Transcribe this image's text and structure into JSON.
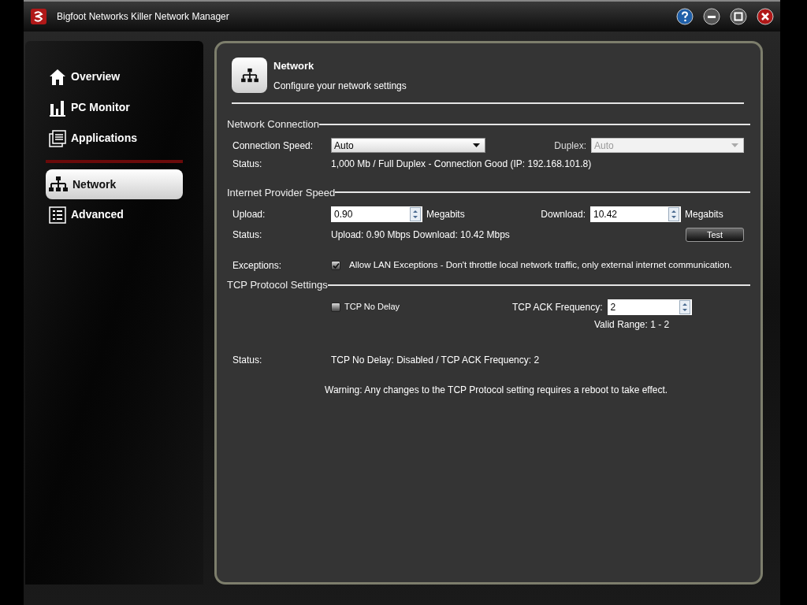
{
  "window": {
    "title": "Bigfoot Networks Killer Network Manager"
  },
  "sidebar": {
    "groups": [
      [
        {
          "label": "Overview",
          "selected": false
        },
        {
          "label": "PC Monitor",
          "selected": false
        },
        {
          "label": "Applications",
          "selected": false
        }
      ],
      [
        {
          "label": "Network",
          "selected": true
        },
        {
          "label": "Advanced",
          "selected": false
        }
      ]
    ]
  },
  "header": {
    "title": "Network",
    "subtitle": "Configure your network settings"
  },
  "network_connection": {
    "heading": "Network Connection",
    "speed_label": "Connection Speed:",
    "speed_value": "Auto",
    "duplex_label": "Duplex:",
    "duplex_value": "Auto",
    "duplex_disabled": true,
    "status_label": "Status:",
    "status": "1,000 Mb / Full Duplex - Connection Good (IP: 192.168.101.8)"
  },
  "provider_speed": {
    "heading": "Internet Provider Speed",
    "upload_label": "Upload:",
    "upload_value": "0.90",
    "upload_unit": "Megabits",
    "download_label": "Download:",
    "download_value": "10.42",
    "download_unit": "Megabits",
    "status_label": "Status:",
    "status": "Upload: 0.90 Mbps Download: 10.42 Mbps",
    "test_button": "Test",
    "exceptions_label": "Exceptions:",
    "exceptions_checkbox": {
      "label": "Allow LAN Exceptions - Don't throttle local network traffic, only external internet communication.",
      "checked": true
    }
  },
  "tcp_settings": {
    "heading": "TCP Protocol Settings",
    "no_delay_checkbox": {
      "label": "TCP No Delay",
      "checked": false
    },
    "ack_label": "TCP ACK Frequency:",
    "ack_value": "2",
    "valid_range": "Valid Range: 1 - 2",
    "status_label": "Status:",
    "status": "TCP No Delay: Disabled / TCP ACK Frequency: 2",
    "warning": "Warning: Any changes to the TCP Protocol setting requires a reboot to take effect."
  }
}
